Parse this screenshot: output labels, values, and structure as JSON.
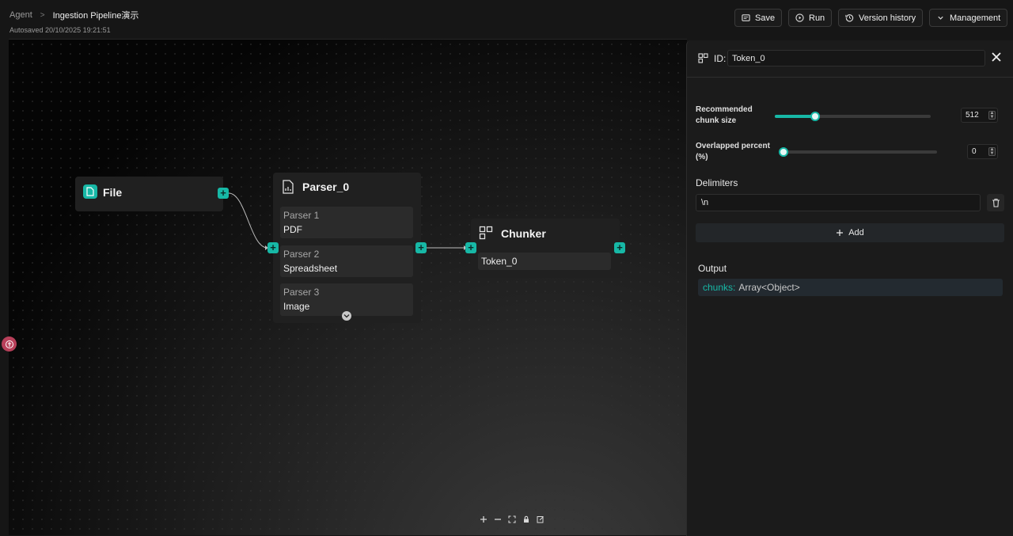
{
  "header": {
    "breadcrumb_root": "Agent",
    "breadcrumb_separator": ">",
    "breadcrumb_current": "Ingestion Pipeline演示",
    "autosave": "Autosaved 20/10/2025 19:21:51",
    "buttons": {
      "save": "Save",
      "run": "Run",
      "version_history": "Version history",
      "management": "Management"
    }
  },
  "canvas": {
    "nodes": {
      "file": {
        "title": "File"
      },
      "parser": {
        "title": "Parser_0",
        "items": [
          {
            "label": "Parser 1",
            "value": "PDF"
          },
          {
            "label": "Parser 2",
            "value": "Spreadsheet"
          },
          {
            "label": "Parser 3",
            "value": "Image"
          }
        ]
      },
      "chunker": {
        "title": "Chunker",
        "value": "Token_0"
      }
    },
    "handle_symbol": "+"
  },
  "panel": {
    "id_label": "ID:",
    "id_value": "Token_0",
    "chunk_size": {
      "label": "Recommended chunk size",
      "value": "512",
      "level": 0.26
    },
    "overlap": {
      "label": "Overlapped percent (%)",
      "value": "0",
      "level": 0.0
    },
    "delimiters_title": "Delimiters",
    "delimiter_value": "\\n",
    "add_label": "Add",
    "output_title": "Output",
    "output_key": "chunks:",
    "output_type": "Array<Object>"
  },
  "colors": {
    "accent": "#17b8a6",
    "background": "#161616"
  }
}
